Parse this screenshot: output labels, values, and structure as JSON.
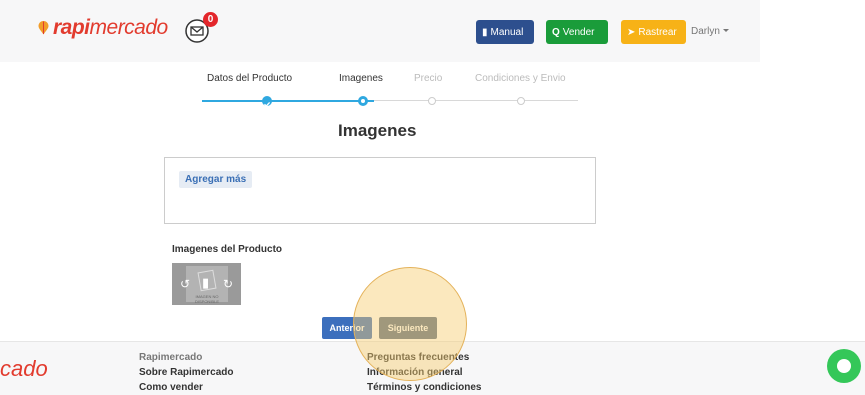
{
  "header": {
    "logo": {
      "bold": "rapi",
      "rest": "mercado"
    },
    "notifications": {
      "count": "0"
    },
    "buttons": {
      "manual": "Manual",
      "vender": "Vender",
      "rastrear": "Rastrear"
    },
    "user": "Darlyn"
  },
  "steps": {
    "labels": [
      "Datos del Producto",
      "Imagenes",
      "Precio",
      "Condiciones y Envio"
    ],
    "current_index": 1
  },
  "main": {
    "title": "Imagenes",
    "add_more": "Agregar más",
    "images_label": "Imagenes del Producto",
    "thumb_caption": "IMAGEN NO DISPONIBLE"
  },
  "nav": {
    "previous": "Anterior",
    "next": "Siguiente"
  },
  "footer": {
    "logo": "cado",
    "col1": [
      "Rapimercado",
      "Sobre Rapimercado",
      "Como vender"
    ],
    "col2": [
      "Preguntas frecuentes",
      "Información general",
      "Términos y condiciones"
    ]
  },
  "colors": {
    "brand": "#e23b2e",
    "progress": "#2fa8e0",
    "manual": "#2d4f8e",
    "vender": "#1a9c3a",
    "rastrear": "#f7b217"
  }
}
